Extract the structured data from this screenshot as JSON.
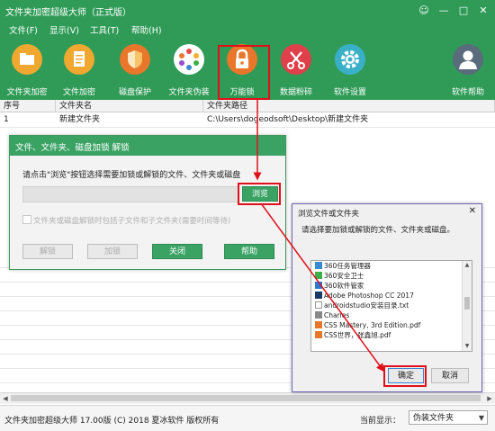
{
  "app": {
    "title": "文件夹加密超级大师（正式版）",
    "window_buttons": [
      "☺",
      "—",
      "□",
      "✕"
    ]
  },
  "menu": [
    "文件(F)",
    "显示(V)",
    "工具(T)",
    "帮助(H)"
  ],
  "toolbar": {
    "items": [
      {
        "label": "文件夹加密",
        "icon": "folder-icon",
        "color": "#f0a830"
      },
      {
        "label": "文件加密",
        "icon": "document-icon",
        "color": "#f0a830"
      },
      {
        "label": "磁盘保护",
        "icon": "shield-icon",
        "color": "#e8762b"
      },
      {
        "label": "文件夹伪装",
        "icon": "palette-icon",
        "color": "#ffffff"
      },
      {
        "label": "万能锁",
        "icon": "lock-icon",
        "color": "#e8762b"
      },
      {
        "label": "数据粉碎",
        "icon": "scissors-icon",
        "color": "#e0404a"
      },
      {
        "label": "软件设置",
        "icon": "gear-icon",
        "color": "#3ab0c8"
      },
      {
        "label": "软件帮助",
        "icon": "user-icon",
        "color": "#5a6b7c"
      }
    ]
  },
  "table": {
    "columns": [
      "序号",
      "文件夹名",
      "文件夹路径"
    ],
    "rows": [
      {
        "index": "1",
        "name": "新建文件夹",
        "path": "C:\\Users\\dogeodsoft\\Desktop\\新建文件夹"
      }
    ]
  },
  "lock_dialog": {
    "title": "文件、文件夹、磁盘加锁 解锁",
    "prompt": "请点击\"浏览\"按钮选择需要加锁或解锁的文件、文件夹或磁盘",
    "path_value": "",
    "browse_label": "浏览",
    "checkbox_label": "文件夹或磁盘解锁时包括子文件和子文件夹(需要时间等待)",
    "buttons": [
      "解锁",
      "加锁",
      "关闭",
      "帮助"
    ]
  },
  "browse_dialog": {
    "title": "浏览文件或文件夹",
    "close": "✕",
    "prompt": "请选择要加锁或解锁的文件、文件夹或磁盘。",
    "items": [
      "360任务管理器",
      "360安全卫士",
      "360软件管家",
      "Adobe Photoshop CC 2017",
      "androidstudio安装目录.txt",
      "Charles",
      "CSS Mastery, 3rd Edition.pdf",
      "CSS世界，张鑫旭.pdf"
    ],
    "ok_label": "确定",
    "cancel_label": "取消"
  },
  "status": {
    "text": "文件夹加密超级大师 17.00版 (C) 2018 夏冰软件 版权所有",
    "display_label": "当前显示：",
    "display_value": "伪装文件夹"
  },
  "colors": {
    "brand_green": "#2f9b57",
    "highlight_red": "#e0101a"
  }
}
